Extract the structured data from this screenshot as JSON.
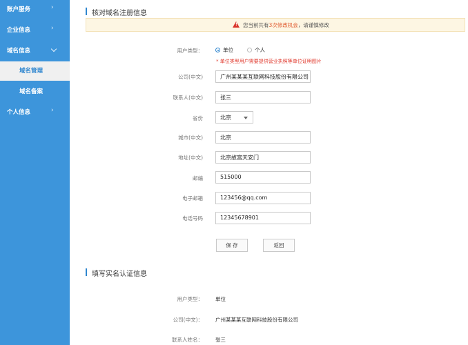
{
  "sidebar": {
    "items": [
      {
        "label": "账户服务"
      },
      {
        "label": "企业信息"
      },
      {
        "label": "域名信息"
      },
      {
        "label": "域名管理"
      },
      {
        "label": "域名备案"
      },
      {
        "label": "个人信息"
      }
    ]
  },
  "section1": {
    "title": "核对域名注册信息",
    "warning": {
      "prefix": "您当前共有",
      "highlight": "3次修改机会",
      "suffix": "，请谨慎修改"
    },
    "user_type": {
      "label": "用户类型：",
      "options": [
        "单位",
        "个人"
      ],
      "selected": "单位"
    },
    "note": "*  单位类型用户需要提供营业执照等单位证明图片",
    "fields": {
      "company": {
        "label": "公司(中文)",
        "value": "广州某某某互联网科技股份有限公司"
      },
      "contact": {
        "label": "联系人(中文)",
        "value": "张三"
      },
      "province": {
        "label": "省份",
        "value": "北京"
      },
      "city": {
        "label": "城市(中文)",
        "value": "北京"
      },
      "address": {
        "label": "地址(中文)",
        "value": "北京故宫天安门"
      },
      "postcode": {
        "label": "邮编",
        "value": "515000"
      },
      "email": {
        "label": "电子邮箱",
        "value": "123456@qq.com"
      },
      "phone": {
        "label": "电话号码",
        "value": "12345678901"
      }
    },
    "buttons": {
      "save": "保 存",
      "back": "返回"
    }
  },
  "section2": {
    "title": "填写实名认证信息",
    "rows": [
      {
        "label": "用户类型：",
        "value": "单位"
      },
      {
        "label": "公司(中文)：",
        "value": "广州某某某互联网科技股份有限公司"
      },
      {
        "label": "联系人姓名：",
        "value": "张三"
      }
    ]
  }
}
